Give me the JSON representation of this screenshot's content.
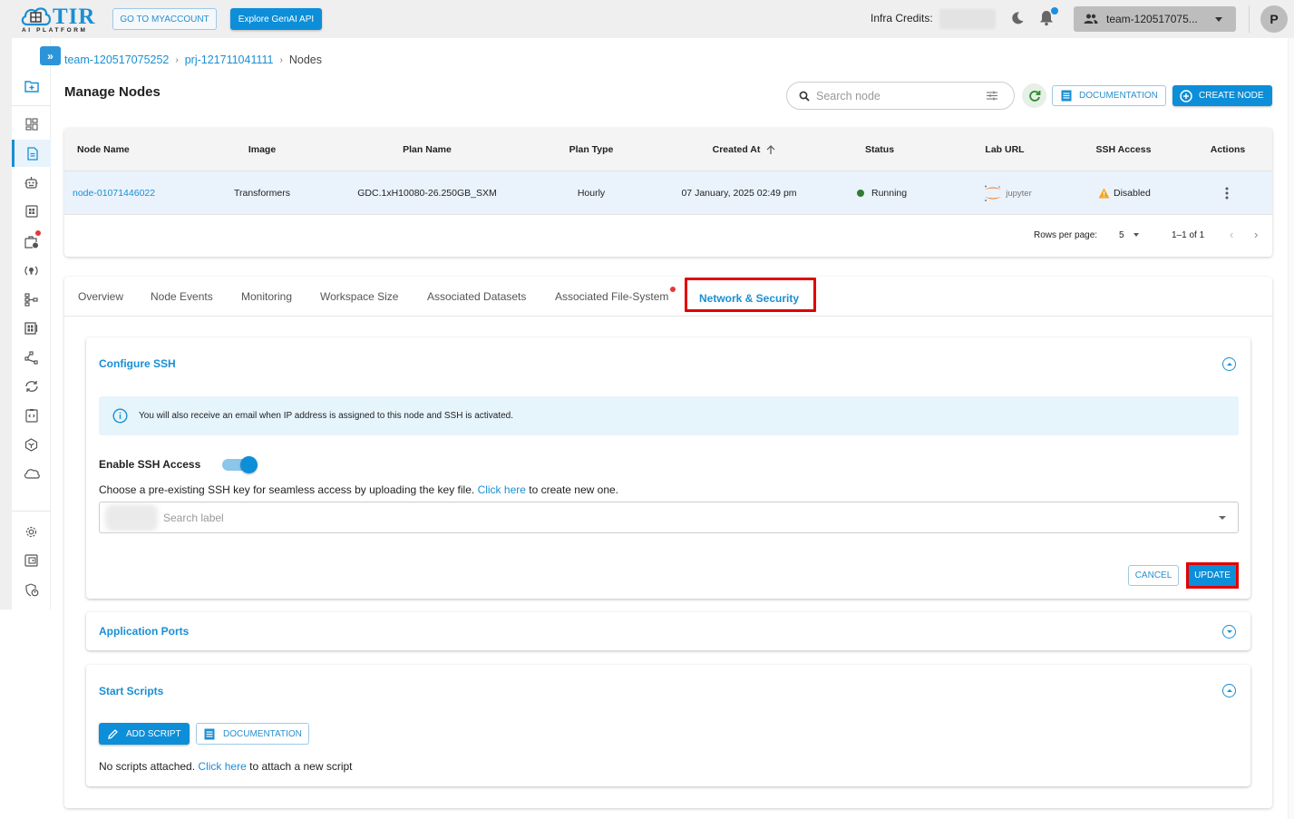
{
  "header": {
    "logo_text": "TIR",
    "logo_subtext": "AI PLATFORM",
    "myaccount_label": "GO TO MYACCOUNT",
    "genai_label": "Explore GenAI API",
    "credits_label": "Infra Credits:",
    "team_selector": "team-120517075...",
    "avatar_initial": "P"
  },
  "sidebar": {
    "items": [
      {
        "icon": "folder-add-icon"
      },
      {
        "icon": "dashboard-icon"
      },
      {
        "icon": "document-icon",
        "active": true
      },
      {
        "icon": "robot-icon"
      },
      {
        "icon": "grid-icon"
      },
      {
        "icon": "briefcase-clock-icon",
        "badge": true
      },
      {
        "icon": "bulb-sync-icon"
      },
      {
        "icon": "pipeline-icon"
      },
      {
        "icon": "registry-icon"
      },
      {
        "icon": "share-nodes-icon"
      },
      {
        "icon": "sync-icon"
      },
      {
        "icon": "code-clipboard-icon"
      },
      {
        "icon": "cube-icon"
      },
      {
        "icon": "cloud-icon"
      },
      {
        "icon": "settings-icon"
      },
      {
        "icon": "wallet-icon"
      },
      {
        "icon": "shield-user-icon"
      }
    ]
  },
  "breadcrumb": {
    "team": "team-120517075252",
    "project": "prj-121711041111",
    "current": "Nodes"
  },
  "page": {
    "title": "Manage Nodes",
    "search_placeholder": "Search node",
    "documentation_label": "DOCUMENTATION",
    "create_label": "CREATE NODE"
  },
  "table": {
    "columns": [
      "Node Name",
      "Image",
      "Plan Name",
      "Plan Type",
      "Created At",
      "Status",
      "Lab URL",
      "SSH Access",
      "Actions"
    ],
    "rows": [
      {
        "node_name": "node-01071446022",
        "image": "Transformers",
        "plan_name": "GDC.1xH10080-26.250GB_SXM",
        "plan_type": "Hourly",
        "created_at": "07 January, 2025 02:49 pm",
        "status": "Running",
        "lab_url": "jupyter",
        "ssh_access": "Disabled"
      }
    ],
    "rows_per_page_label": "Rows per page:",
    "rows_per_page": "5",
    "range": "1–1 of 1"
  },
  "tabs": [
    {
      "label": "Overview"
    },
    {
      "label": "Node Events"
    },
    {
      "label": "Monitoring"
    },
    {
      "label": "Workspace Size"
    },
    {
      "label": "Associated Datasets"
    },
    {
      "label": "Associated File-System"
    },
    {
      "label": "Network & Security",
      "active": true
    }
  ],
  "configure_ssh": {
    "title": "Configure SSH",
    "info": "You will also receive an email when IP address is assigned to this node and SSH is activated.",
    "enable_label": "Enable SSH Access",
    "enabled": true,
    "choose_text_pre": "Choose a pre-existing SSH key for seamless access by uploading the key file.",
    "choose_link": "Click here",
    "choose_text_post": "to create new one.",
    "key_placeholder": "Search label",
    "cancel_label": "CANCEL",
    "update_label": "UPDATE"
  },
  "application_ports": {
    "title": "Application Ports"
  },
  "start_scripts": {
    "title": "Start Scripts",
    "add_label": "ADD SCRIPT",
    "doc_label": "DOCUMENTATION",
    "empty_pre": "No scripts attached.",
    "empty_link": "Click here",
    "empty_post": "to attach a new script"
  }
}
